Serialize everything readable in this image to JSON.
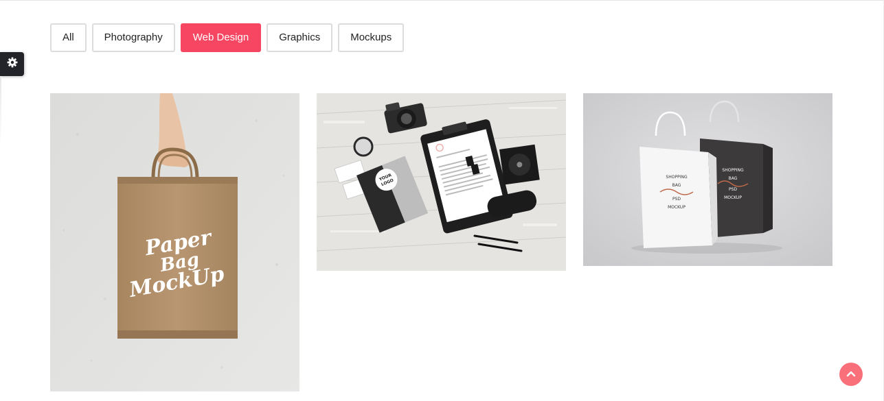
{
  "filters": [
    {
      "label": "All",
      "active": false
    },
    {
      "label": "Photography",
      "active": false
    },
    {
      "label": "Web Design",
      "active": true
    },
    {
      "label": "Graphics",
      "active": false
    },
    {
      "label": "Mockups",
      "active": false
    }
  ],
  "colors": {
    "accent": "#f74662",
    "back_to_top": "#f9707a",
    "settings_tab": "#222429"
  },
  "icons": {
    "settings": "gear-icon",
    "back_to_top": "chevron-up-icon"
  },
  "portfolio": [
    {
      "image": "paper-bag-mockup",
      "text_lines": [
        "Paper",
        "Bag",
        "MockUp"
      ]
    },
    {
      "image": "stationery-mockup",
      "text_lines": [
        "YOUR",
        "LOGO"
      ]
    },
    {
      "image": "shopping-bag-mockup",
      "text_lines": [
        "SHOPPING",
        "BAG",
        "PSD",
        "MOCKUP"
      ]
    }
  ]
}
